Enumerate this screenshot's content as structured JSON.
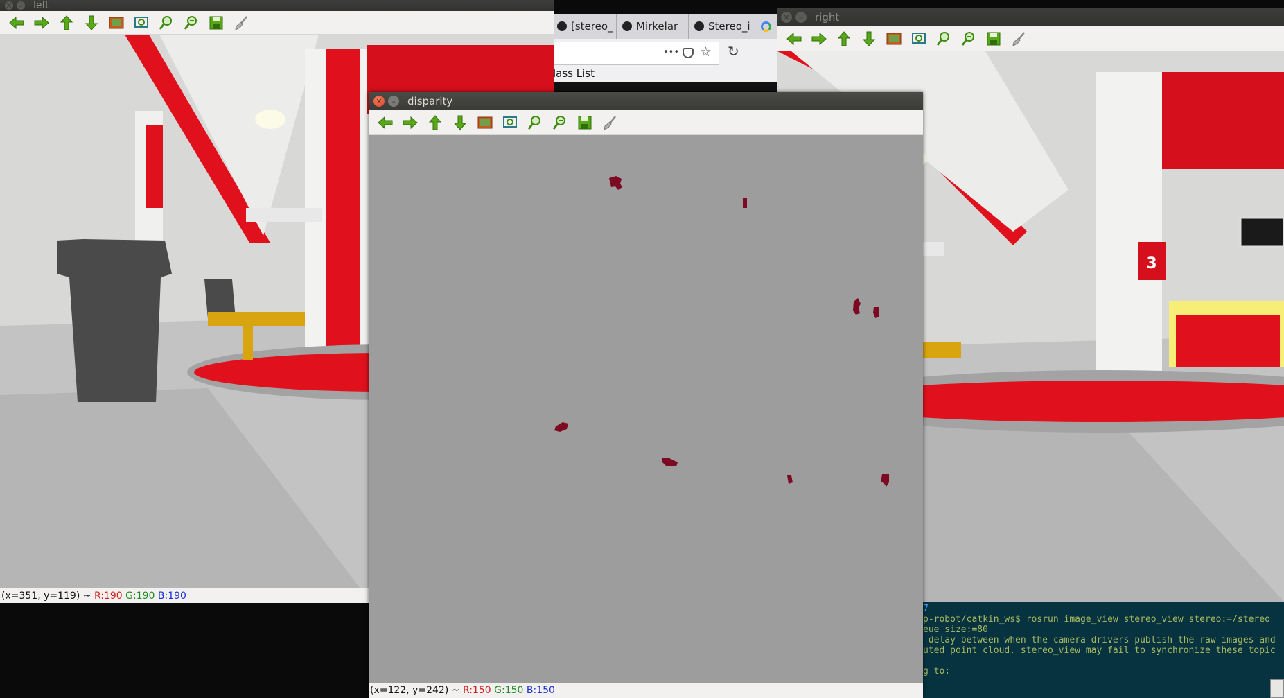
{
  "windows": {
    "left": {
      "title": "left",
      "status": {
        "coords": "(x=351, y=119)",
        "sep": " ~ ",
        "r": "R:190",
        "g": "G:190",
        "b": "B:190"
      }
    },
    "right": {
      "title": "right"
    },
    "disparity": {
      "title": "disparity",
      "status": {
        "coords": "(x=122, y=242)",
        "sep": " ~ ",
        "r": "R:150",
        "g": "G:150",
        "b": "B:150"
      }
    }
  },
  "toolbar_icons": [
    "back-arrow-icon",
    "forward-arrow-icon",
    "up-arrow-icon",
    "down-arrow-icon",
    "image-icon",
    "zoom-fit-icon",
    "zoom-in-icon",
    "zoom-out-icon",
    "save-icon",
    "brush-icon"
  ],
  "browser": {
    "tabs": [
      {
        "label": "[stereo_",
        "icon": "github-icon"
      },
      {
        "label": "Mirkelar",
        "icon": "github-icon"
      },
      {
        "label": "Stereo_i",
        "icon": "github-icon"
      }
    ],
    "url_menu": "•••",
    "page_text": "lass List"
  },
  "right_scene": {
    "sign_number": "3"
  },
  "terminal": {
    "lines": [
      "p-robot/catkin_ws$ rosrun image_view stereo_view stereo:=/stereo",
      "eue_size:=80",
      " delay between when the camera drivers publish the raw images and",
      "uted point cloud. stereo_view may fail to synchronize these topic",
      "",
      "g to:"
    ],
    "marker": "7"
  },
  "colors": {
    "blob": "#7d0a22",
    "disparity_bg": "#9d9d9d",
    "accent_red": "#e0101c"
  }
}
